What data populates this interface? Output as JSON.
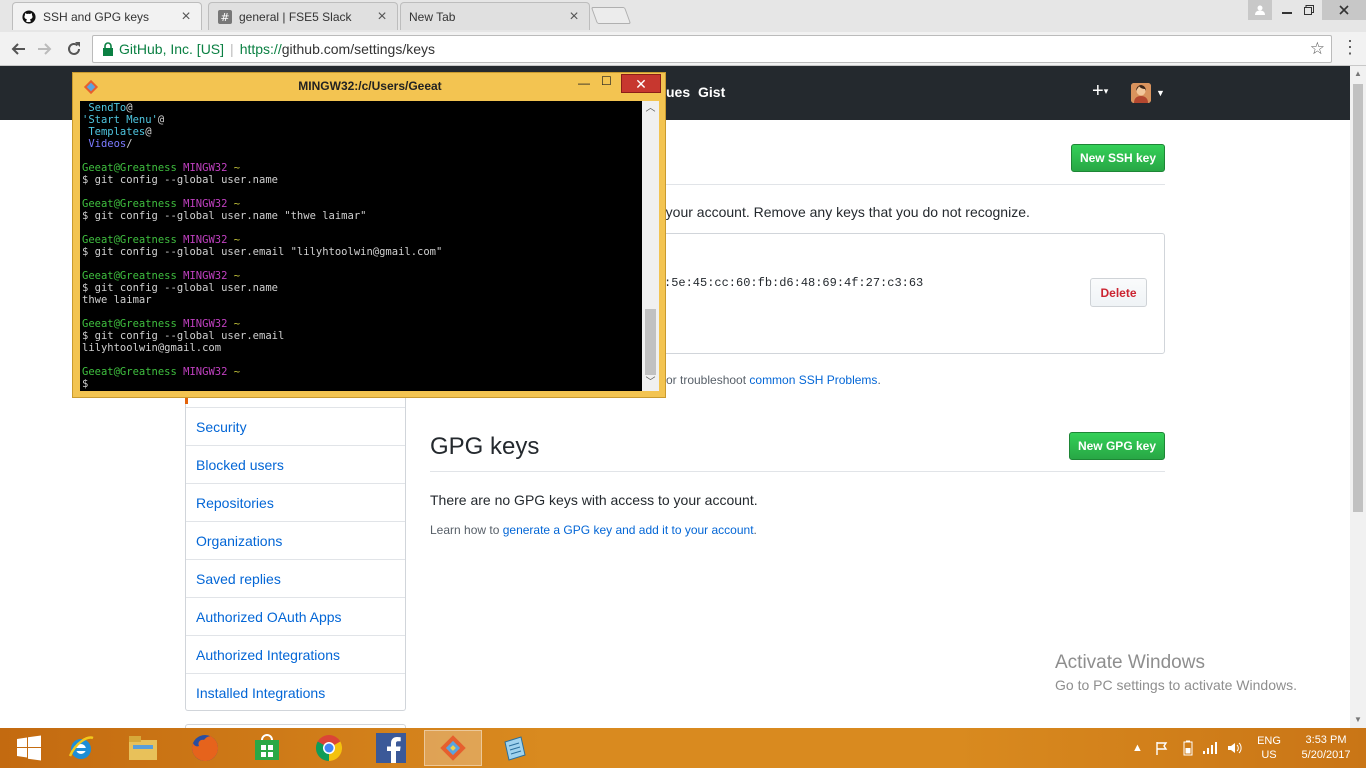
{
  "browser": {
    "tabs": [
      {
        "title": "SSH and GPG keys",
        "icon": "github-icon"
      },
      {
        "title": "general | FSE5 Slack",
        "icon": "slack-hash-icon"
      },
      {
        "title": "New Tab",
        "icon": ""
      }
    ],
    "tab_close": "×",
    "ev_name": "GitHub, Inc. [US]",
    "url_scheme": "https://",
    "url_rest": "github.com/settings/keys"
  },
  "github": {
    "header_issues_fragment": "ues",
    "header_gist": "Gist",
    "ssh": {
      "new_button": "New SSH key",
      "intro_fragment": "h your account. Remove any keys that you do not recognize.",
      "fingerprint_fragment": ":5e:45:cc:60:fb:d6:48:69:4f:27:c3:63",
      "delete_button": "Delete",
      "help_prefix": "or troubleshoot ",
      "help_link": "common SSH Problems",
      "help_suffix": "."
    },
    "gpg": {
      "title": "GPG keys",
      "new_button": "New GPG key",
      "empty_text": "There are no GPG keys with access to your account.",
      "help_prefix": "Learn how to ",
      "help_link": "generate a GPG key and add it to your account",
      "help_suffix": "."
    },
    "sidebar_items": [
      "Security",
      "Blocked users",
      "Repositories",
      "Organizations",
      "Saved replies",
      "Authorized OAuth Apps",
      "Authorized Integrations",
      "Installed Integrations"
    ]
  },
  "terminal": {
    "title": "MINGW32:/c/Users/Geeat",
    "close_glyph": "✕",
    "lines": [
      [
        {
          "t": " SendTo",
          "c": "cyan"
        },
        {
          "t": "@",
          "c": "white"
        }
      ],
      [
        {
          "t": "'Start Menu'",
          "c": "cyan"
        },
        {
          "t": "@",
          "c": "white"
        }
      ],
      [
        {
          "t": " Templates",
          "c": "cyan"
        },
        {
          "t": "@",
          "c": "white"
        }
      ],
      [
        {
          "t": " Videos",
          "c": "blue"
        },
        {
          "t": "/",
          "c": "white"
        }
      ],
      [],
      [
        {
          "t": "Geeat@Greatness ",
          "c": "green"
        },
        {
          "t": "MINGW32 ",
          "c": "mag"
        },
        {
          "t": "~",
          "c": "yel"
        }
      ],
      [
        {
          "t": "$ git config --global user.name",
          "c": "white"
        }
      ],
      [],
      [
        {
          "t": "Geeat@Greatness ",
          "c": "green"
        },
        {
          "t": "MINGW32 ",
          "c": "mag"
        },
        {
          "t": "~",
          "c": "yel"
        }
      ],
      [
        {
          "t": "$ git config --global user.name \"thwe laimar\"",
          "c": "white"
        }
      ],
      [],
      [
        {
          "t": "Geeat@Greatness ",
          "c": "green"
        },
        {
          "t": "MINGW32 ",
          "c": "mag"
        },
        {
          "t": "~",
          "c": "yel"
        }
      ],
      [
        {
          "t": "$ git config --global user.email \"lilyhtoolwin@gmail.com\"",
          "c": "white"
        }
      ],
      [],
      [
        {
          "t": "Geeat@Greatness ",
          "c": "green"
        },
        {
          "t": "MINGW32 ",
          "c": "mag"
        },
        {
          "t": "~",
          "c": "yel"
        }
      ],
      [
        {
          "t": "$ git config --global user.name",
          "c": "white"
        }
      ],
      [
        {
          "t": "thwe laimar",
          "c": "white"
        }
      ],
      [],
      [
        {
          "t": "Geeat@Greatness ",
          "c": "green"
        },
        {
          "t": "MINGW32 ",
          "c": "mag"
        },
        {
          "t": "~",
          "c": "yel"
        }
      ],
      [
        {
          "t": "$ git config --global user.email",
          "c": "white"
        }
      ],
      [
        {
          "t": "lilyhtoolwin@gmail.com",
          "c": "white"
        }
      ],
      [],
      [
        {
          "t": "Geeat@Greatness ",
          "c": "green"
        },
        {
          "t": "MINGW32 ",
          "c": "mag"
        },
        {
          "t": "~",
          "c": "yel"
        }
      ],
      [
        {
          "t": "$",
          "c": "white"
        }
      ]
    ]
  },
  "watermark": {
    "title": "Activate Windows",
    "subtitle": "Go to PC settings to activate Windows."
  },
  "taskbar": {
    "apps": [
      "windows-start-icon",
      "internet-explorer-icon",
      "file-explorer-icon",
      "firefox-icon",
      "windows-store-icon",
      "chrome-icon",
      "facebook-icon",
      "git-bash-icon",
      "notepad-icon"
    ],
    "lang_top": "ENG",
    "lang_bottom": "US",
    "time": "3:53 PM",
    "date": "5/20/2017"
  },
  "colors": {
    "github_header": "#24292e",
    "green_button": "#28a745",
    "link": "#0366d6",
    "terminal_frame": "#f3c451",
    "taskbar": "#d98a1f"
  }
}
